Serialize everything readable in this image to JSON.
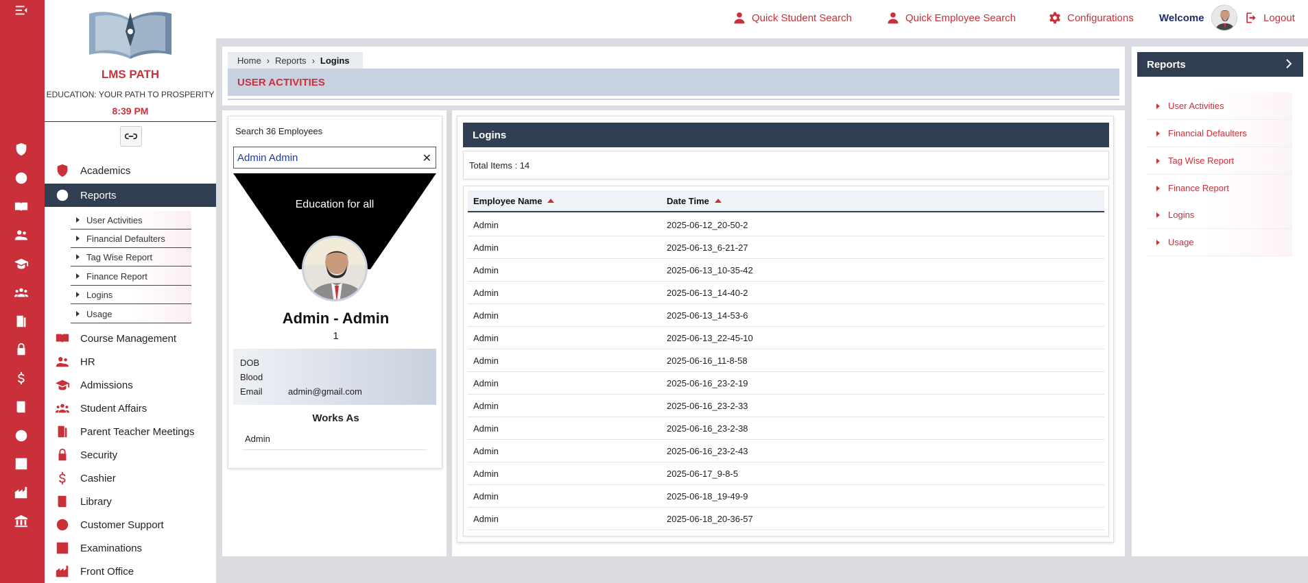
{
  "brand": {
    "name": "LMS PATH",
    "tagline": "EDUCATION: YOUR PATH TO PROSPERITY",
    "time": "8:39 PM"
  },
  "sidebar": {
    "items": [
      {
        "label": "Academics",
        "icon": "shield-alert-icon"
      },
      {
        "label": "Reports",
        "icon": "alert-circle-icon"
      },
      {
        "label": "Course Management",
        "icon": "book-open-icon"
      },
      {
        "label": "HR",
        "icon": "users-icon"
      },
      {
        "label": "Admissions",
        "icon": "graduation-cap-icon"
      },
      {
        "label": "Student Affairs",
        "icon": "group-icon"
      },
      {
        "label": "Parent Teacher Meetings",
        "icon": "door-icon"
      },
      {
        "label": "Security",
        "icon": "lock-icon"
      },
      {
        "label": "Cashier",
        "icon": "dollar-icon"
      },
      {
        "label": "Library",
        "icon": "book-icon"
      },
      {
        "label": "Customer Support",
        "icon": "alert-circle-icon"
      },
      {
        "label": "Examinations",
        "icon": "checklist-icon"
      },
      {
        "label": "Front Office",
        "icon": "building-icon"
      }
    ],
    "report_subitems": [
      {
        "label": "User Activities"
      },
      {
        "label": "Financial Defaulters"
      },
      {
        "label": "Tag Wise Report"
      },
      {
        "label": "Finance Report"
      },
      {
        "label": "Logins"
      },
      {
        "label": "Usage"
      }
    ]
  },
  "header": {
    "quick_student": "Quick Student Search",
    "quick_employee": "Quick Employee Search",
    "configurations": "Configurations",
    "welcome": "Welcome",
    "logout": "Logout"
  },
  "breadcrumb": {
    "home": "Home",
    "reports": "Reports",
    "current": "Logins"
  },
  "page_title": "USER ACTIVITIES",
  "employee": {
    "search_label": "Search 36 Employees",
    "search_value": "Admin Admin",
    "banner": "Education for all",
    "name": "Admin - Admin",
    "id": "1",
    "dob_label": "DOB",
    "dob_value": "",
    "blood_label": "Blood",
    "blood_value": "",
    "email_label": "Email",
    "email_value": "admin@gmail.com",
    "works_as_title": "Works As",
    "works_as": "Admin"
  },
  "logins": {
    "title": "Logins",
    "total_items": "Total Items : 14",
    "columns": [
      "Employee Name",
      "Date Time"
    ],
    "rows": [
      [
        "Admin",
        "2025-06-12_20-50-2"
      ],
      [
        "Admin",
        "2025-06-13_6-21-27"
      ],
      [
        "Admin",
        "2025-06-13_10-35-42"
      ],
      [
        "Admin",
        "2025-06-13_14-40-2"
      ],
      [
        "Admin",
        "2025-06-13_14-53-6"
      ],
      [
        "Admin",
        "2025-06-13_22-45-10"
      ],
      [
        "Admin",
        "2025-06-16_11-8-58"
      ],
      [
        "Admin",
        "2025-06-16_23-2-19"
      ],
      [
        "Admin",
        "2025-06-16_23-2-33"
      ],
      [
        "Admin",
        "2025-06-16_23-2-38"
      ],
      [
        "Admin",
        "2025-06-16_23-2-43"
      ],
      [
        "Admin",
        "2025-06-17_9-8-5"
      ],
      [
        "Admin",
        "2025-06-18_19-49-9"
      ],
      [
        "Admin",
        "2025-06-18_20-36-57"
      ]
    ]
  },
  "right_panel": {
    "title": "Reports",
    "items": [
      {
        "label": "User Activities"
      },
      {
        "label": "Financial Defaulters"
      },
      {
        "label": "Tag Wise Report"
      },
      {
        "label": "Finance Report"
      },
      {
        "label": "Logins"
      },
      {
        "label": "Usage"
      }
    ]
  },
  "colors": {
    "accent_red": "#c9303a",
    "navy": "#2f3e50",
    "title_bar": "#c8d1df"
  }
}
